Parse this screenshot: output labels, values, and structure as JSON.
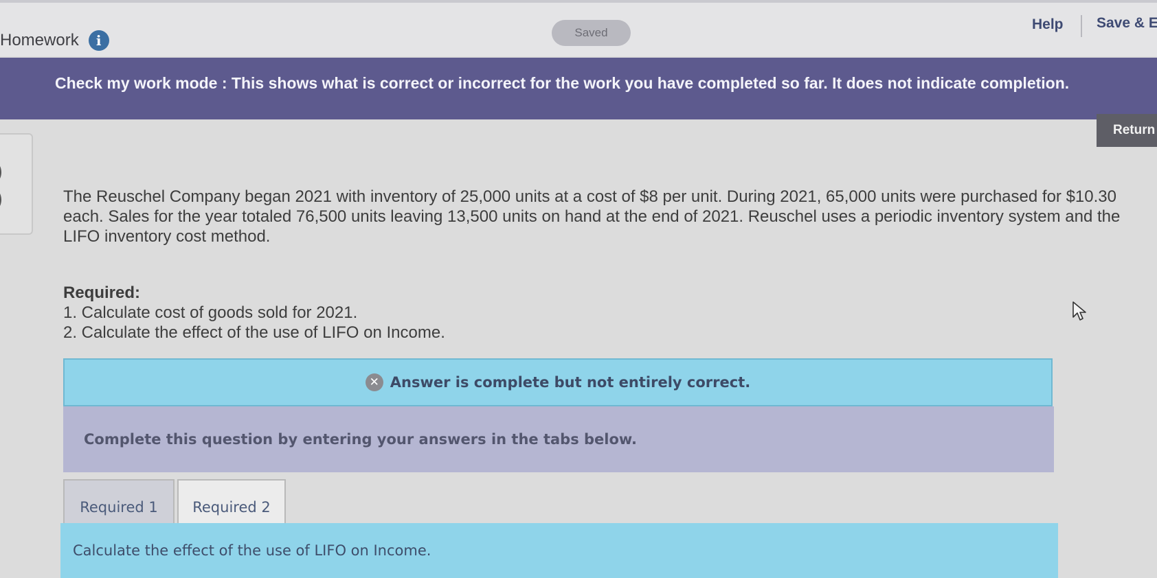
{
  "header": {
    "title": "Homework",
    "saved_label": "Saved",
    "help_label": "Help",
    "save_exit_label": "Save & E"
  },
  "banner": {
    "text": "Check my work mode : This shows what is correct or incorrect for the work you have completed so far. It does not indicate completion."
  },
  "return_label": "Return",
  "problem": {
    "text": "The Reuschel Company began 2021 with inventory of 25,000 units at a cost of $8 per unit. During 2021, 65,000 units were purchased for $10.30 each. Sales for the year totaled 76,500 units leaving 13,500 units on hand at the end of 2021. Reuschel uses a periodic inventory system and the LIFO inventory cost method.",
    "required_heading": "Required:",
    "required_items": [
      "1. Calculate cost of goods sold for 2021.",
      "2. Calculate the effect of the use of LIFO on Income."
    ]
  },
  "answer_status": "Answer is complete but not entirely correct.",
  "instructions": "Complete this question by entering your answers in the tabs below.",
  "tabs": [
    {
      "label": "Required 1"
    },
    {
      "label": "Required 2"
    }
  ],
  "active_tab_prompt": "Calculate the effect of the use of LIFO on Income.",
  "colors": {
    "banner": "#5d5a8e",
    "answer_box": "#8fd4ea",
    "instructions_box": "#b5b6d2",
    "info_icon": "#3b6fa3"
  },
  "icons": {
    "info": "info-icon",
    "status": "x-circle-icon",
    "pointer": "mouse-cursor-icon"
  }
}
